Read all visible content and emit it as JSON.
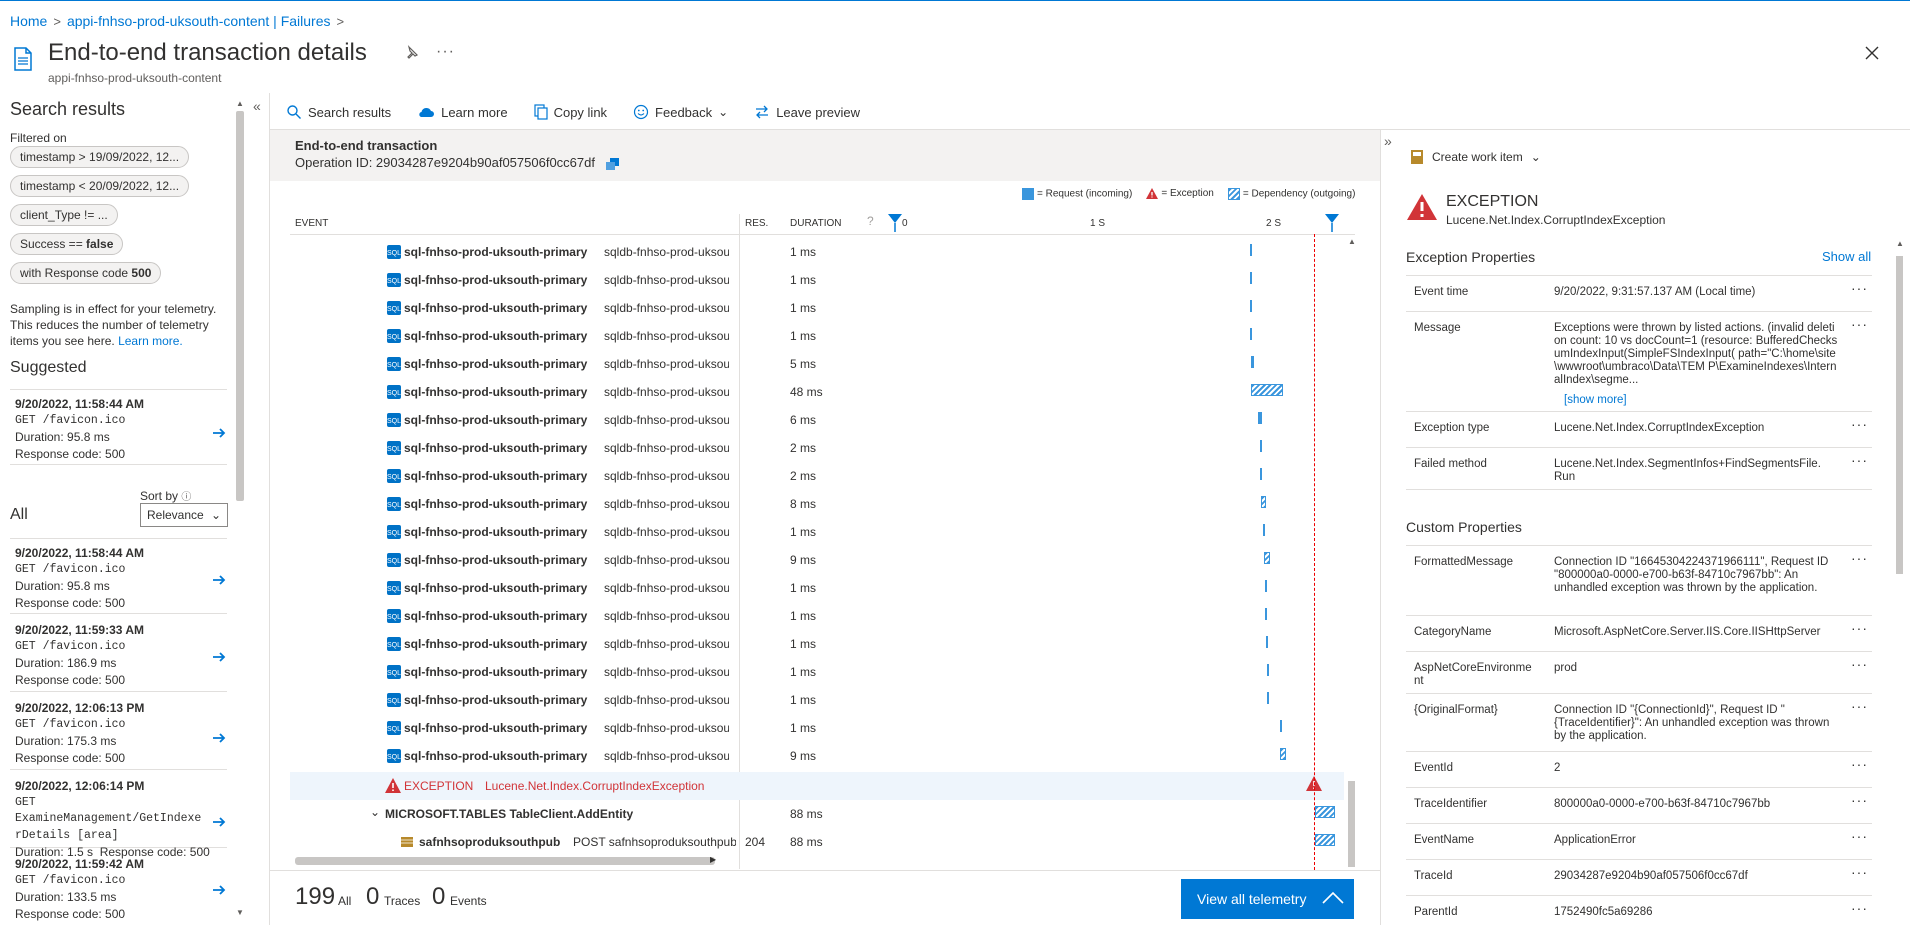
{
  "breadcrumb": [
    "Home",
    "appi-fnhso-prod-uksouth-content | Failures"
  ],
  "header": {
    "title": "End-to-end transaction details",
    "subtitle": "appi-fnhso-prod-uksouth-content"
  },
  "left_panel": {
    "title": "Search results",
    "filtered_label": "Filtered on",
    "filters": [
      "timestamp > 19/09/2022, 12...",
      "timestamp < 20/09/2022, 12...",
      "client_Type != ...",
      "Success == ",
      "false",
      "with Response code ",
      "500"
    ],
    "sampling_note": "Sampling is in effect for your telemetry. This reduces the number of telemetry items you see here.",
    "learn_more": "Learn more.",
    "suggested_title": "Suggested",
    "suggested": {
      "time": "9/20/2022, 11:58:44 AM",
      "req": "GET /favicon.ico",
      "dur": "Duration: 95.8 ms",
      "code": "Response code: 500"
    },
    "all_title": "All",
    "sort_label": "Sort by",
    "sort_value": "Relevance",
    "results": [
      {
        "time": "9/20/2022, 11:58:44 AM",
        "req": "GET /favicon.ico",
        "dur": "Duration: 95.8 ms",
        "code": "Response code: 500"
      },
      {
        "time": "9/20/2022, 11:59:33 AM",
        "req": "GET /favicon.ico",
        "dur": "Duration: 186.9 ms",
        "code": "Response code: 500"
      },
      {
        "time": "9/20/2022, 12:06:13 PM",
        "req": "GET /favicon.ico",
        "dur": "Duration: 175.3 ms",
        "code": "Response code: 500"
      },
      {
        "time": "9/20/2022, 12:06:14 PM",
        "req": "GET ExamineManagement/GetIndexe",
        "req2": "rDetails [area]",
        "dur": "Duration: 1.5 s",
        "code": "Response code: 500"
      },
      {
        "time": "9/20/2022, 11:59:42 AM",
        "req": "GET /favicon.ico",
        "dur": "Duration: 133.5 ms",
        "code": "Response code: 500"
      }
    ]
  },
  "toolbar": {
    "search": "Search results",
    "learn": "Learn more",
    "copy": "Copy link",
    "feedback": "Feedback",
    "leave": "Leave preview"
  },
  "transaction": {
    "title": "End-to-end transaction",
    "operation": "Operation ID: 29034287e9204b90af057506f0cc67df",
    "legend": {
      "request": "= Request (incoming)",
      "exception": "= Exception",
      "dependency": "= Dependency (outgoing)"
    },
    "columns": {
      "event": "EVENT",
      "res": "RES.",
      "duration": "DURATION",
      "t0": "0",
      "t1": "1 S",
      "t2": "2 S"
    },
    "rows": [
      {
        "name": "sql-fnhso-prod-uksouth-primary",
        "target": "sqldb-fnhso-prod-uksouth",
        "duration": "1 ms",
        "pos": 0.806
      },
      {
        "name": "sql-fnhso-prod-uksouth-primary",
        "target": "sqldb-fnhso-prod-uksouth",
        "duration": "1 ms",
        "pos": 0.806
      },
      {
        "name": "sql-fnhso-prod-uksouth-primary",
        "target": "sqldb-fnhso-prod-uksouth",
        "duration": "1 ms",
        "pos": 0.807
      },
      {
        "name": "sql-fnhso-prod-uksouth-primary",
        "target": "sqldb-fnhso-prod-uksouth",
        "duration": "1 ms",
        "pos": 0.807
      },
      {
        "name": "sql-fnhso-prod-uksouth-primary",
        "target": "sqldb-fnhso-prod-uksouth",
        "duration": "5 ms",
        "pos": 0.808
      },
      {
        "name": "sql-fnhso-prod-uksouth-primary",
        "target": "sqldb-fnhso-prod-uksouth",
        "duration": "48 ms",
        "pos": 0.81
      },
      {
        "name": "sql-fnhso-prod-uksouth-primary",
        "target": "sqldb-fnhso-prod-uksouth",
        "duration": "6 ms",
        "pos": 0.826
      },
      {
        "name": "sql-fnhso-prod-uksouth-primary",
        "target": "sqldb-fnhso-prod-uksouth",
        "duration": "2 ms",
        "pos": 0.829
      },
      {
        "name": "sql-fnhso-prod-uksouth-primary",
        "target": "sqldb-fnhso-prod-uksouth",
        "duration": "2 ms",
        "pos": 0.83
      },
      {
        "name": "sql-fnhso-prod-uksouth-primary",
        "target": "sqldb-fnhso-prod-uksouth",
        "duration": "8 ms",
        "pos": 0.831
      },
      {
        "name": "sql-fnhso-prod-uksouth-primary",
        "target": "sqldb-fnhso-prod-uksouth",
        "duration": "1 ms",
        "pos": 0.837
      },
      {
        "name": "sql-fnhso-prod-uksouth-primary",
        "target": "sqldb-fnhso-prod-uksouth",
        "duration": "9 ms",
        "pos": 0.838
      },
      {
        "name": "sql-fnhso-prod-uksouth-primary",
        "target": "sqldb-fnhso-prod-uksouth",
        "duration": "1 ms",
        "pos": 0.841
      },
      {
        "name": "sql-fnhso-prod-uksouth-primary",
        "target": "sqldb-fnhso-prod-uksouth",
        "duration": "1 ms",
        "pos": 0.842
      },
      {
        "name": "sql-fnhso-prod-uksouth-primary",
        "target": "sqldb-fnhso-prod-uksouth",
        "duration": "1 ms",
        "pos": 0.843
      },
      {
        "name": "sql-fnhso-prod-uksouth-primary",
        "target": "sqldb-fnhso-prod-uksouth",
        "duration": "1 ms",
        "pos": 0.845
      },
      {
        "name": "sql-fnhso-prod-uksouth-primary",
        "target": "sqldb-fnhso-prod-uksouth",
        "duration": "1 ms",
        "pos": 0.846
      },
      {
        "name": "sql-fnhso-prod-uksouth-primary",
        "target": "sqldb-fnhso-prod-uksouth",
        "duration": "1 ms",
        "pos": 0.874
      },
      {
        "name": "sql-fnhso-prod-uksouth-primary",
        "target": "sqldb-fnhso-prod-uksouth",
        "duration": "9 ms",
        "pos": 0.876
      }
    ],
    "exception_row": {
      "label": "EXCEPTION",
      "type": "Lucene.Net.Index.CorruptIndexException"
    },
    "tables_row": {
      "name": "MICROSOFT.TABLES TableClient.AddEntity",
      "duration": "88 ms"
    },
    "blob_row": {
      "name": "safnhsoproduksouthpub",
      "target": "POST safnhsoproduksouthpub/",
      "res": "204",
      "duration": "88 ms"
    },
    "counts": {
      "all_n": "199",
      "all_l": "All",
      "traces_n": "0",
      "traces_l": "Traces",
      "events_n": "0",
      "events_l": "Events"
    },
    "view_all": "View all telemetry"
  },
  "detail": {
    "create_work_item": "Create work item",
    "exception_title": "EXCEPTION",
    "exception_type": "Lucene.Net.Index.CorruptIndexException",
    "exc_props_title": "Exception Properties",
    "show_all": "Show all",
    "exc_props": [
      {
        "k": "Event time",
        "v": "9/20/2022, 9:31:57.137 AM (Local time)"
      },
      {
        "k": "Message",
        "v": "Exceptions were thrown by listed actions. (invalid deletion count: 10 vs docCount=1 (resource: BufferedChecksumIndexInput(SimpleFSIndexInput( path=\"C:\\home\\site\\wwwroot\\umbraco\\Data\\TEM P\\ExamineIndexes\\InternalIndex\\segme...",
        "more": "[show more]"
      },
      {
        "k": "Exception type",
        "v": "Lucene.Net.Index.CorruptIndexException"
      },
      {
        "k": "Failed method",
        "v": "Lucene.Net.Index.SegmentInfos+FindSegmentsFile. Run"
      }
    ],
    "custom_props_title": "Custom Properties",
    "custom_props": [
      {
        "k": "FormattedMessage",
        "v": "Connection ID \"16645304224371966111\", Request ID \"800000a0-0000-e700-b63f-84710c7967bb\": An unhandled exception was thrown by the application."
      },
      {
        "k": "CategoryName",
        "v": "Microsoft.AspNetCore.Server.IIS.Core.IISHttpServer"
      },
      {
        "k": "AspNetCoreEnvironme nt",
        "v": "prod"
      },
      {
        "k": "{OriginalFormat}",
        "v": "Connection ID \"{ConnectionId}\", Request ID \"{TraceIdentifier}\": An unhandled exception was thrown by the application."
      },
      {
        "k": "EventId",
        "v": "2"
      },
      {
        "k": "TraceIdentifier",
        "v": "800000a0-0000-e700-b63f-84710c7967bb"
      },
      {
        "k": "EventName",
        "v": "ApplicationError"
      },
      {
        "k": "TraceId",
        "v": "29034287e9204b90af057506f0cc67df"
      },
      {
        "k": "ParentId",
        "v": "1752490fc5a69286"
      }
    ]
  },
  "colors": {
    "accent": "#0078d4",
    "error": "#d13438"
  }
}
